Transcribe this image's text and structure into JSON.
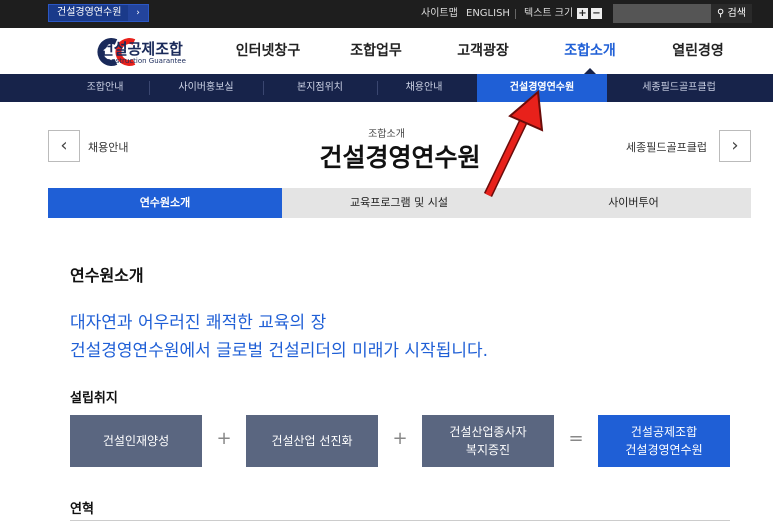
{
  "utility": {
    "site_select": "건설경영연수원",
    "select_arrow": "›",
    "sitemap": "사이트맵",
    "english": "ENGLISH",
    "text_size": "텍스트 크기",
    "plus": "+",
    "minus": "−",
    "search_icon": "⚲",
    "search_label": "검색",
    "search_placeholder": ""
  },
  "logo": {
    "ko": "건설공제조합",
    "en": "Construction Guarantee"
  },
  "gnav": [
    {
      "label": "인터넷창구"
    },
    {
      "label": "조합업무"
    },
    {
      "label": "고객광장"
    },
    {
      "label": "조합소개"
    },
    {
      "label": "열린경영"
    }
  ],
  "subnav": [
    {
      "label": "조합안내"
    },
    {
      "label": "사이버홍보실"
    },
    {
      "label": "본지점위치"
    },
    {
      "label": "채용안내"
    },
    {
      "label": "건설경영연수원"
    },
    {
      "label": "세종필드골프클럽"
    }
  ],
  "page": {
    "prev_label": "채용안내",
    "prev_icon": "‹",
    "next_label": "세종필드골프클럽",
    "next_icon": "›",
    "breadcrumb": "조합소개",
    "title": "건설경영연수원"
  },
  "tabs": [
    {
      "label": "연수원소개"
    },
    {
      "label": "교육프로그램 및 시설"
    },
    {
      "label": "사이버투어"
    }
  ],
  "content": {
    "section_title": "연수원소개",
    "lead_1": "대자연과 어우러진 쾌적한 교육의 장",
    "lead_2": "건설경영연수원에서 글로벌 건설리더의 미래가 시작됩니다.",
    "purpose_title": "설립취지",
    "boxes": [
      {
        "line1": "건설인재양성",
        "line2": ""
      },
      {
        "line1": "건설산업 선진화",
        "line2": ""
      },
      {
        "line1": "건설산업종사자",
        "line2": "복지증진"
      },
      {
        "line1": "건설공제조합",
        "line2": "건설경영연수원"
      }
    ],
    "ops": [
      "+",
      "+",
      "="
    ],
    "history_title": "연혁"
  },
  "colors": {
    "accent": "#1f5fd6",
    "navy": "#17234a",
    "box": "#5a6680",
    "annotation_arrow": "#e8211b"
  }
}
